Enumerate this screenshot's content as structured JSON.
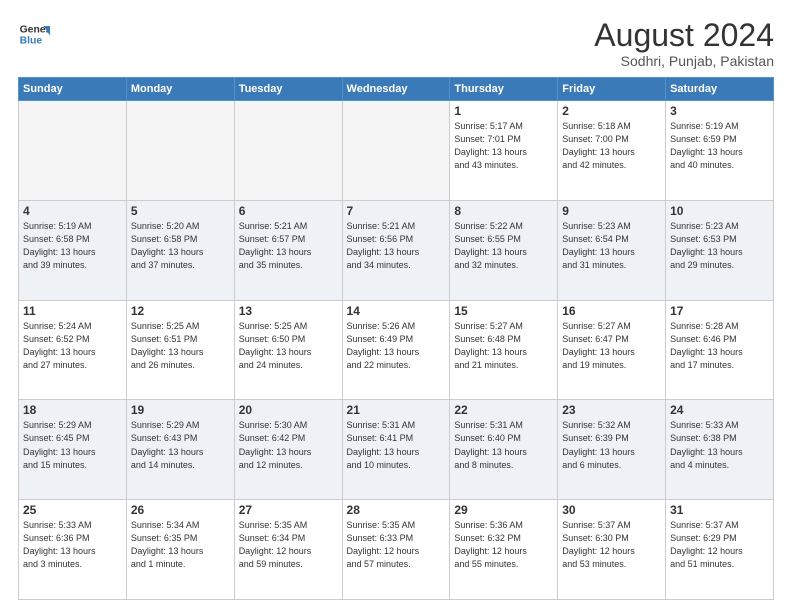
{
  "header": {
    "logo_line1": "General",
    "logo_line2": "Blue",
    "title": "August 2024",
    "subtitle": "Sodhri, Punjab, Pakistan"
  },
  "weekdays": [
    "Sunday",
    "Monday",
    "Tuesday",
    "Wednesday",
    "Thursday",
    "Friday",
    "Saturday"
  ],
  "weeks": [
    [
      {
        "day": "",
        "info": ""
      },
      {
        "day": "",
        "info": ""
      },
      {
        "day": "",
        "info": ""
      },
      {
        "day": "",
        "info": ""
      },
      {
        "day": "1",
        "info": "Sunrise: 5:17 AM\nSunset: 7:01 PM\nDaylight: 13 hours\nand 43 minutes."
      },
      {
        "day": "2",
        "info": "Sunrise: 5:18 AM\nSunset: 7:00 PM\nDaylight: 13 hours\nand 42 minutes."
      },
      {
        "day": "3",
        "info": "Sunrise: 5:19 AM\nSunset: 6:59 PM\nDaylight: 13 hours\nand 40 minutes."
      }
    ],
    [
      {
        "day": "4",
        "info": "Sunrise: 5:19 AM\nSunset: 6:58 PM\nDaylight: 13 hours\nand 39 minutes."
      },
      {
        "day": "5",
        "info": "Sunrise: 5:20 AM\nSunset: 6:58 PM\nDaylight: 13 hours\nand 37 minutes."
      },
      {
        "day": "6",
        "info": "Sunrise: 5:21 AM\nSunset: 6:57 PM\nDaylight: 13 hours\nand 35 minutes."
      },
      {
        "day": "7",
        "info": "Sunrise: 5:21 AM\nSunset: 6:56 PM\nDaylight: 13 hours\nand 34 minutes."
      },
      {
        "day": "8",
        "info": "Sunrise: 5:22 AM\nSunset: 6:55 PM\nDaylight: 13 hours\nand 32 minutes."
      },
      {
        "day": "9",
        "info": "Sunrise: 5:23 AM\nSunset: 6:54 PM\nDaylight: 13 hours\nand 31 minutes."
      },
      {
        "day": "10",
        "info": "Sunrise: 5:23 AM\nSunset: 6:53 PM\nDaylight: 13 hours\nand 29 minutes."
      }
    ],
    [
      {
        "day": "11",
        "info": "Sunrise: 5:24 AM\nSunset: 6:52 PM\nDaylight: 13 hours\nand 27 minutes."
      },
      {
        "day": "12",
        "info": "Sunrise: 5:25 AM\nSunset: 6:51 PM\nDaylight: 13 hours\nand 26 minutes."
      },
      {
        "day": "13",
        "info": "Sunrise: 5:25 AM\nSunset: 6:50 PM\nDaylight: 13 hours\nand 24 minutes."
      },
      {
        "day": "14",
        "info": "Sunrise: 5:26 AM\nSunset: 6:49 PM\nDaylight: 13 hours\nand 22 minutes."
      },
      {
        "day": "15",
        "info": "Sunrise: 5:27 AM\nSunset: 6:48 PM\nDaylight: 13 hours\nand 21 minutes."
      },
      {
        "day": "16",
        "info": "Sunrise: 5:27 AM\nSunset: 6:47 PM\nDaylight: 13 hours\nand 19 minutes."
      },
      {
        "day": "17",
        "info": "Sunrise: 5:28 AM\nSunset: 6:46 PM\nDaylight: 13 hours\nand 17 minutes."
      }
    ],
    [
      {
        "day": "18",
        "info": "Sunrise: 5:29 AM\nSunset: 6:45 PM\nDaylight: 13 hours\nand 15 minutes."
      },
      {
        "day": "19",
        "info": "Sunrise: 5:29 AM\nSunset: 6:43 PM\nDaylight: 13 hours\nand 14 minutes."
      },
      {
        "day": "20",
        "info": "Sunrise: 5:30 AM\nSunset: 6:42 PM\nDaylight: 13 hours\nand 12 minutes."
      },
      {
        "day": "21",
        "info": "Sunrise: 5:31 AM\nSunset: 6:41 PM\nDaylight: 13 hours\nand 10 minutes."
      },
      {
        "day": "22",
        "info": "Sunrise: 5:31 AM\nSunset: 6:40 PM\nDaylight: 13 hours\nand 8 minutes."
      },
      {
        "day": "23",
        "info": "Sunrise: 5:32 AM\nSunset: 6:39 PM\nDaylight: 13 hours\nand 6 minutes."
      },
      {
        "day": "24",
        "info": "Sunrise: 5:33 AM\nSunset: 6:38 PM\nDaylight: 13 hours\nand 4 minutes."
      }
    ],
    [
      {
        "day": "25",
        "info": "Sunrise: 5:33 AM\nSunset: 6:36 PM\nDaylight: 13 hours\nand 3 minutes."
      },
      {
        "day": "26",
        "info": "Sunrise: 5:34 AM\nSunset: 6:35 PM\nDaylight: 13 hours\nand 1 minute."
      },
      {
        "day": "27",
        "info": "Sunrise: 5:35 AM\nSunset: 6:34 PM\nDaylight: 12 hours\nand 59 minutes."
      },
      {
        "day": "28",
        "info": "Sunrise: 5:35 AM\nSunset: 6:33 PM\nDaylight: 12 hours\nand 57 minutes."
      },
      {
        "day": "29",
        "info": "Sunrise: 5:36 AM\nSunset: 6:32 PM\nDaylight: 12 hours\nand 55 minutes."
      },
      {
        "day": "30",
        "info": "Sunrise: 5:37 AM\nSunset: 6:30 PM\nDaylight: 12 hours\nand 53 minutes."
      },
      {
        "day": "31",
        "info": "Sunrise: 5:37 AM\nSunset: 6:29 PM\nDaylight: 12 hours\nand 51 minutes."
      }
    ]
  ]
}
